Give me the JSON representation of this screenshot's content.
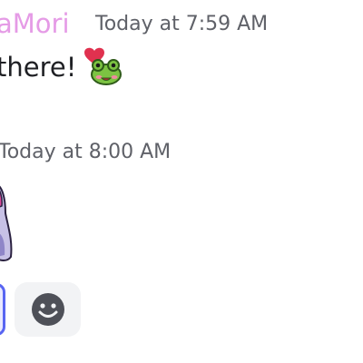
{
  "message1": {
    "username": "aMori",
    "timestamp": "Today at 7:59 AM",
    "text": "there!",
    "emoji": "frog-love-emoji"
  },
  "message2": {
    "timestamp": "Today at 8:00 AM",
    "sticker": "character-sticker"
  },
  "reactions": {
    "active_reaction_icon": "reaction-chip",
    "add_reaction_icon": "smiley-face-icon"
  },
  "colors": {
    "username": "#e59be6",
    "timestamp": "#5f6168",
    "text": "#1f2024",
    "accent": "#5865f2",
    "reaction_bg": "#f2f3f5"
  }
}
